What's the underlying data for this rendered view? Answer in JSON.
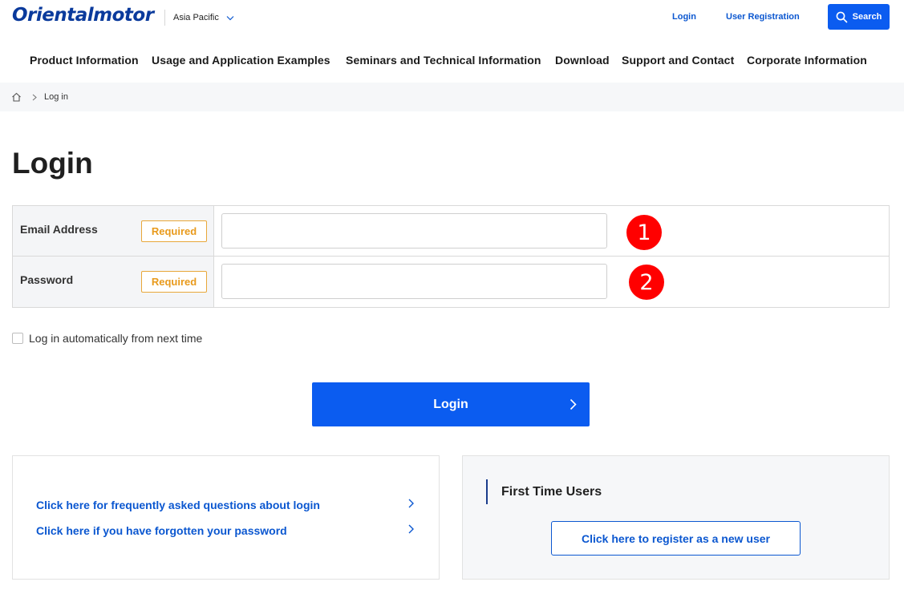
{
  "header": {
    "logo_text": "Orientalmotor",
    "region": "Asia Pacific",
    "login_link": "Login",
    "registration_link": "User Registration",
    "search_label": "Search",
    "accent_color": "#0b5cf0"
  },
  "nav": {
    "items": [
      "Product Information",
      "Usage and Application Examples",
      "Seminars and Technical Information",
      "Download",
      "Support and Contact",
      "Corporate Information"
    ]
  },
  "breadcrumb": {
    "home_icon": "home-icon",
    "current": "Log in"
  },
  "page": {
    "title": "Login"
  },
  "form": {
    "email_label": "Email Address",
    "password_label": "Password",
    "required_badge": "Required",
    "email_value": "",
    "password_value": "",
    "email_marker": "1",
    "password_marker": "2",
    "auto_login_label": "Log in automatically from next time",
    "auto_login_checked": false,
    "submit_label": "Login"
  },
  "help": {
    "faq_link": "Click here for frequently asked questions about login",
    "forgot_link": "Click here if you have forgotten your password"
  },
  "first_time": {
    "title": "First Time Users",
    "register_button": "Click here to register as a new user"
  }
}
